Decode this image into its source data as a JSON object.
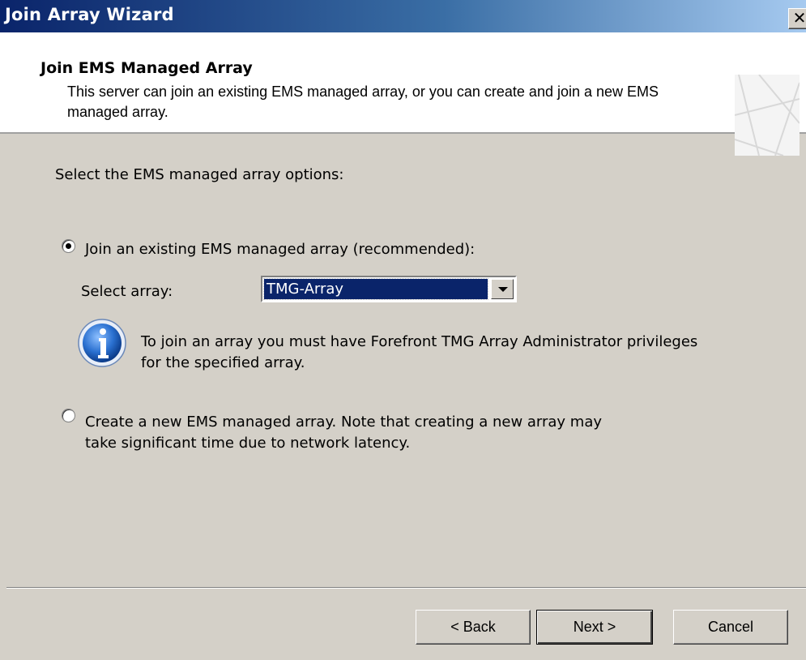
{
  "window": {
    "title": "Join Array Wizard",
    "close_label": "✕"
  },
  "header": {
    "title": "Join EMS Managed Array",
    "description": "This server can join an existing EMS managed array, or you can create and join a new EMS managed array."
  },
  "content": {
    "prompt": "Select the EMS managed array options:",
    "option_join": {
      "label": "Join an existing EMS managed array (recommended):",
      "selected": true
    },
    "select_array": {
      "label": "Select array:",
      "value": "TMG-Array"
    },
    "info": {
      "icon": "info-icon",
      "line1": "To join an array you must have Forefront TMG Array Administrator privileges",
      "line2": "for the specified array."
    },
    "option_create": {
      "line1": "Create a new EMS managed array. Note that creating a new array may",
      "line2": "take significant time due to network latency.",
      "selected": false
    }
  },
  "buttons": {
    "back": "< Back",
    "next": "Next >",
    "cancel": "Cancel"
  },
  "colors": {
    "titlebar": "#0a246a",
    "selection": "#0a246a",
    "dialog_bg": "#d4d0c8",
    "info_icon": "#1e5fc8"
  }
}
